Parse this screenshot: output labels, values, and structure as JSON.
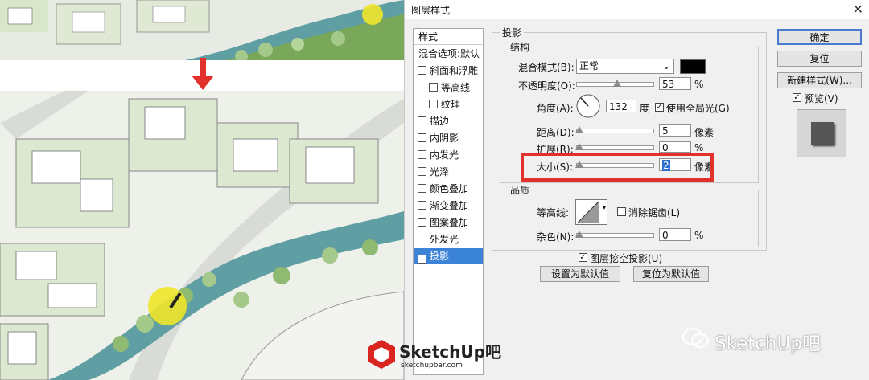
{
  "dialog": {
    "title": "图层样式",
    "close_glyph": "✕"
  },
  "style_list": {
    "header": "样式",
    "blend_options": "混合选项:默认",
    "items": [
      {
        "label": "斜面和浮雕",
        "checked": false,
        "indent": false
      },
      {
        "label": "等高线",
        "checked": false,
        "indent": true
      },
      {
        "label": "纹理",
        "checked": false,
        "indent": true
      },
      {
        "label": "描边",
        "checked": false,
        "indent": false
      },
      {
        "label": "内阴影",
        "checked": false,
        "indent": false
      },
      {
        "label": "内发光",
        "checked": false,
        "indent": false
      },
      {
        "label": "光泽",
        "checked": false,
        "indent": false
      },
      {
        "label": "颜色叠加",
        "checked": false,
        "indent": false
      },
      {
        "label": "渐变叠加",
        "checked": false,
        "indent": false
      },
      {
        "label": "图案叠加",
        "checked": false,
        "indent": false
      },
      {
        "label": "外发光",
        "checked": false,
        "indent": false
      },
      {
        "label": "投影",
        "checked": true,
        "indent": false,
        "selected": true
      }
    ]
  },
  "shadow": {
    "section_title": "投影",
    "structure_title": "结构",
    "blend_mode_label": "混合模式(B):",
    "blend_mode_value": "正常",
    "shadow_color": "#000000",
    "opacity_label": "不透明度(O):",
    "opacity_value": "53",
    "opacity_unit": "%",
    "angle_label": "角度(A):",
    "angle_value": "132",
    "angle_unit": "度",
    "global_light_label": "使用全局光(G)",
    "global_light_checked": true,
    "distance_label": "距离(D):",
    "distance_value": "5",
    "distance_unit": "像素",
    "spread_label": "扩展(R):",
    "spread_value": "0",
    "spread_unit": "%",
    "size_label": "大小(S):",
    "size_value": "2",
    "size_unit": "像素",
    "quality_title": "品质",
    "contour_label": "等高线:",
    "antialias_label": "消除锯齿(L)",
    "antialias_checked": false,
    "noise_label": "杂色(N):",
    "noise_value": "0",
    "noise_unit": "%",
    "knockout_label": "图层挖空投影(U)",
    "knockout_checked": true,
    "make_default": "设置为默认值",
    "reset_default": "复位为默认值"
  },
  "buttons": {
    "ok": "确定",
    "reset": "复位",
    "new_style": "新建样式(W)...",
    "preview_label": "预览(V)",
    "preview_checked": true
  },
  "watermark": {
    "wechat_text": "SketchUp吧",
    "logo_text": "SketchUp吧",
    "logo_url": "sketchupbar.com"
  },
  "colors": {
    "highlight_red": "#e2302d",
    "selection_blue": "#3b83d6",
    "river": "#5f9ea3",
    "foliage": "#7aa85a"
  }
}
